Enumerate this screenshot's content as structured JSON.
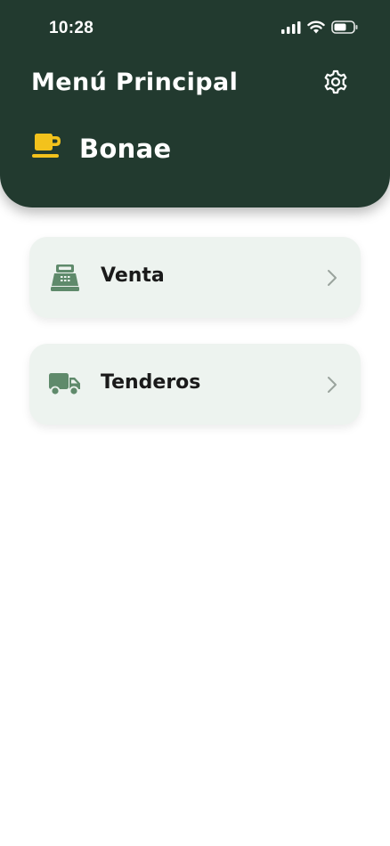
{
  "status_bar": {
    "time": "10:28",
    "icons": [
      "signal-icon",
      "wifi-icon",
      "battery-icon"
    ]
  },
  "header": {
    "title": "Menú Principal",
    "settings_icon": "gear-icon",
    "store": {
      "icon": "coffee-cup-icon",
      "name": "Bonae"
    }
  },
  "menu": {
    "items": [
      {
        "label": "Venta",
        "icon": "cash-register-icon"
      },
      {
        "label": "Tenderos",
        "icon": "truck-icon"
      }
    ]
  },
  "colors": {
    "header_bg": "#223a2f",
    "card_bg": "#edf3ef",
    "icon_green": "#5f8a6b",
    "store_icon_yellow": "#f3c21c",
    "chevron": "#9aa39d"
  }
}
